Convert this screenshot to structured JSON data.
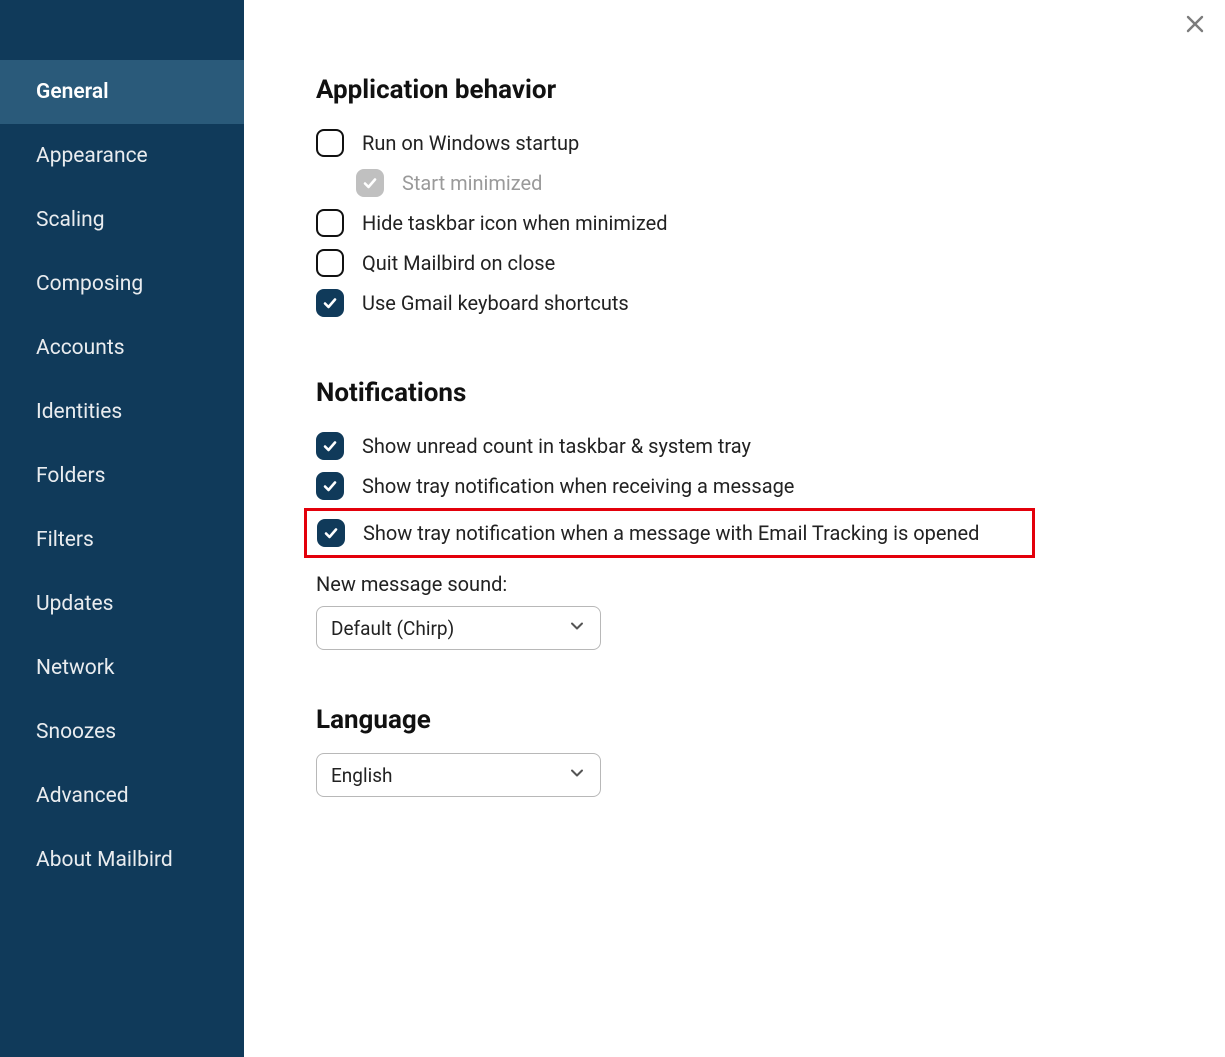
{
  "sidebar": {
    "items": [
      {
        "label": "General",
        "active": true
      },
      {
        "label": "Appearance",
        "active": false
      },
      {
        "label": "Scaling",
        "active": false
      },
      {
        "label": "Composing",
        "active": false
      },
      {
        "label": "Accounts",
        "active": false
      },
      {
        "label": "Identities",
        "active": false
      },
      {
        "label": "Folders",
        "active": false
      },
      {
        "label": "Filters",
        "active": false
      },
      {
        "label": "Updates",
        "active": false
      },
      {
        "label": "Network",
        "active": false
      },
      {
        "label": "Snoozes",
        "active": false
      },
      {
        "label": "Advanced",
        "active": false
      },
      {
        "label": "About Mailbird",
        "active": false
      }
    ]
  },
  "sections": {
    "app_behavior": {
      "title": "Application behavior",
      "run_on_startup": {
        "label": "Run on Windows startup",
        "checked": false
      },
      "start_minimized": {
        "label": "Start minimized",
        "checked": true,
        "disabled": true
      },
      "hide_taskbar": {
        "label": "Hide taskbar icon when minimized",
        "checked": false
      },
      "quit_on_close": {
        "label": "Quit Mailbird on close",
        "checked": false
      },
      "gmail_shortcuts": {
        "label": "Use Gmail keyboard shortcuts",
        "checked": true
      }
    },
    "notifications": {
      "title": "Notifications",
      "unread_count": {
        "label": "Show unread count in taskbar & system tray",
        "checked": true
      },
      "tray_receive": {
        "label": "Show tray notification when receiving a message",
        "checked": true
      },
      "tray_tracking": {
        "label": "Show tray notification when a message with Email Tracking is opened",
        "checked": true,
        "highlight": true
      },
      "sound_label": "New message sound:",
      "sound_value": "Default (Chirp)"
    },
    "language": {
      "title": "Language",
      "value": "English"
    }
  }
}
